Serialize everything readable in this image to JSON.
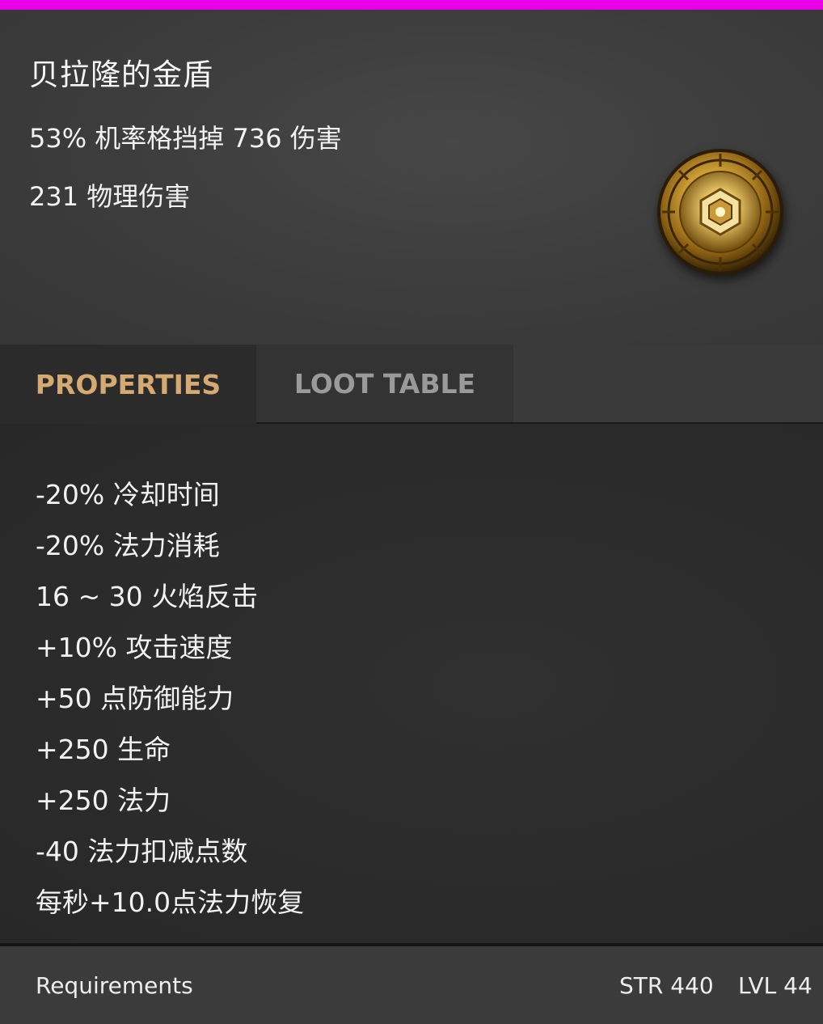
{
  "item": {
    "name": "贝拉隆的金盾",
    "stats": [
      "53% 机率格挡掉 736 伤害",
      "231 物理伤害"
    ],
    "icon": "gold-shield-icon"
  },
  "tabs": [
    {
      "label": "PROPERTIES",
      "active": true
    },
    {
      "label": "LOOT TABLE",
      "active": false
    }
  ],
  "properties": [
    "-20% 冷却时间",
    "-20% 法力消耗",
    "16 ~ 30 火焰反击",
    "+10% 攻击速度",
    "+50 点防御能力",
    "+250 生命",
    "+250 法力",
    "-40 法力扣减点数",
    "每秒+10.0点法力恢复"
  ],
  "requirements": {
    "label": "Requirements",
    "str": "STR 440",
    "lvl": "LVL 44"
  },
  "colors": {
    "accent_bar": "#e800e8",
    "active_tab_text": "#d4aa72",
    "inactive_tab_text": "#9a9a9a"
  }
}
